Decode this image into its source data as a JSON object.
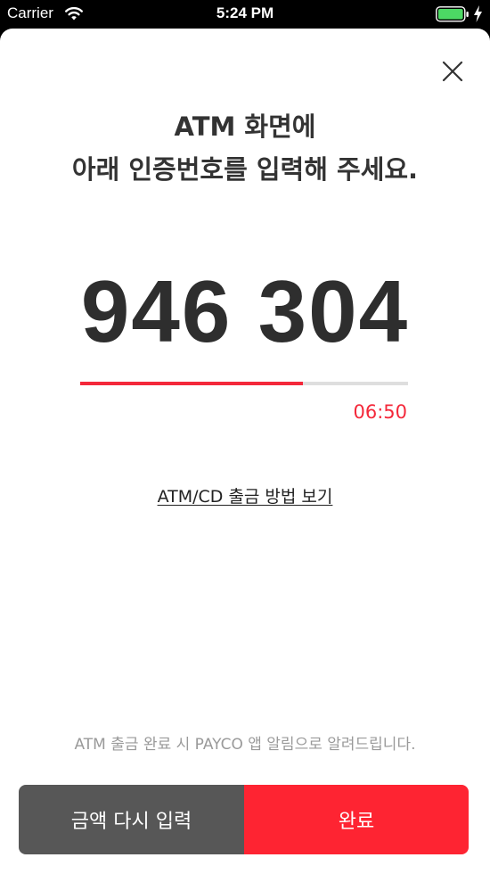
{
  "status_bar": {
    "carrier": "Carrier",
    "time": "5:24 PM",
    "battery_color": "#4cd964"
  },
  "dialog": {
    "title_line1": "ATM 화면에",
    "title_line2": "아래 인증번호를 입력해 주세요.",
    "code": "946 304",
    "progress_fraction": 0.68,
    "timer": "06:50",
    "guide_link": "ATM/CD 출금 방법 보기",
    "notice": "ATM 출금 완료 시 PAYCO 앱 알림으로 알려드립니다.",
    "reenter_button": "금액 다시 입력",
    "done_button": "완료"
  },
  "colors": {
    "accent": "#f4283a",
    "secondary_button": "#575757",
    "primary_button": "#fe2432"
  },
  "icons": {
    "close": "close-icon",
    "wifi": "wifi-icon",
    "battery": "battery-icon",
    "charging": "charging-bolt-icon"
  }
}
